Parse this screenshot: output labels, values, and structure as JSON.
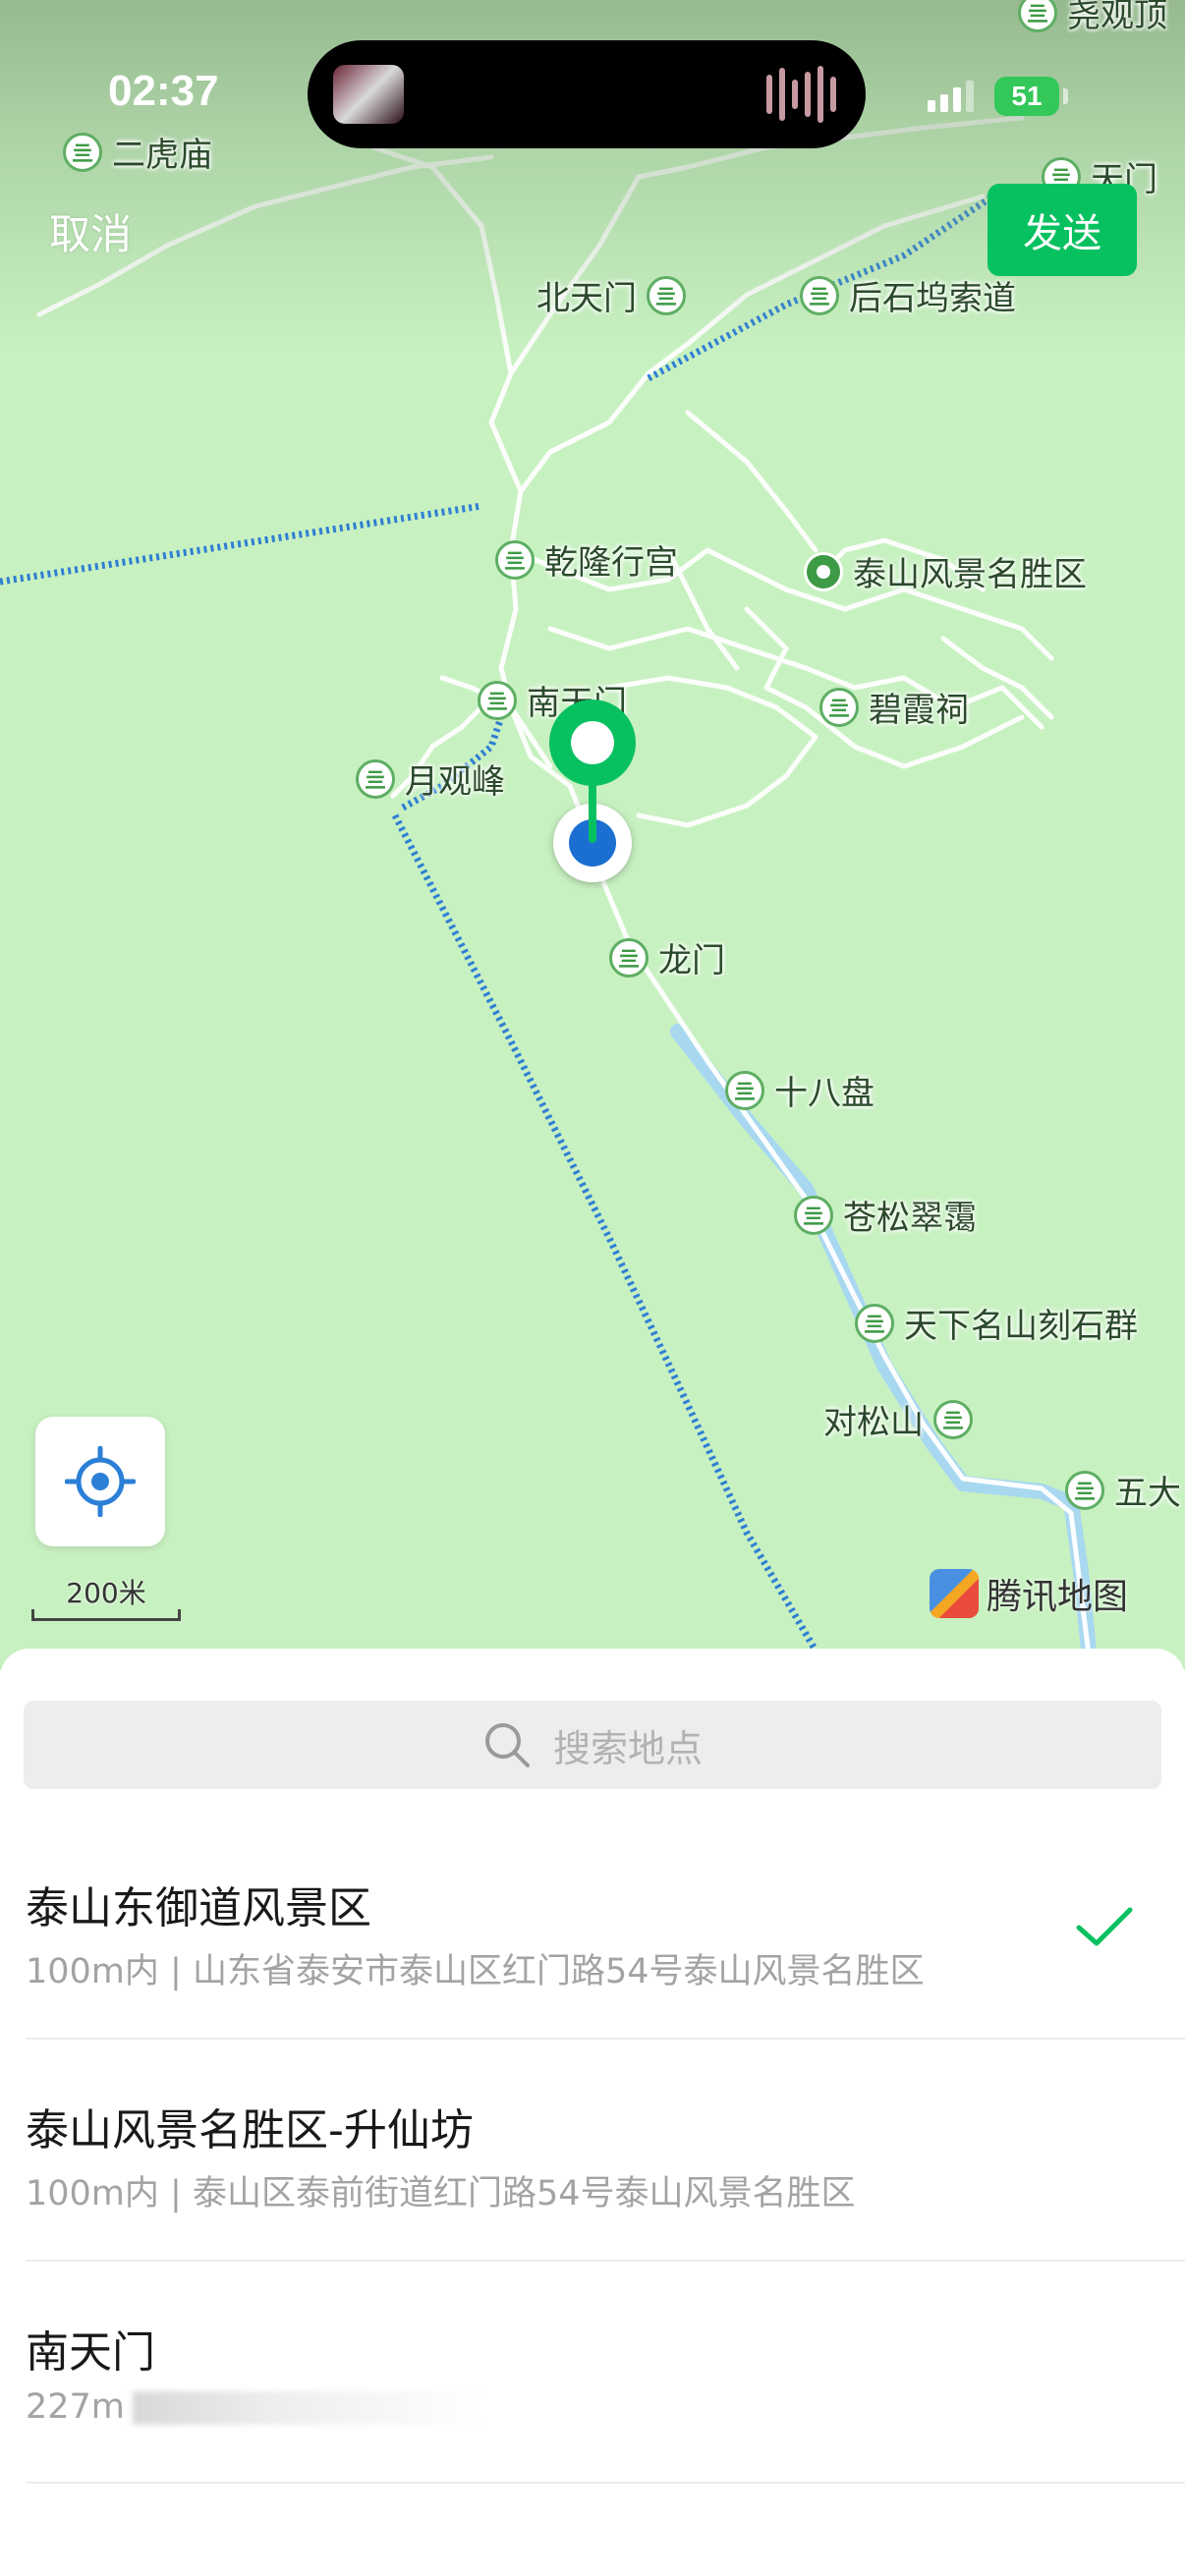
{
  "status_bar": {
    "time": "02:37",
    "battery": "51"
  },
  "header": {
    "cancel_label": "取消",
    "send_label": "发送"
  },
  "map": {
    "pois": [
      {
        "label": "二虎庙"
      },
      {
        "label": "尧观顶"
      },
      {
        "label": "北天门"
      },
      {
        "label": "后石坞索道"
      },
      {
        "label": "乾隆行宫"
      },
      {
        "label": "泰山风景名胜区"
      },
      {
        "label": "南天门"
      },
      {
        "label": "碧霞祠"
      },
      {
        "label": "月观峰"
      },
      {
        "label": "龙门"
      },
      {
        "label": "十八盘"
      },
      {
        "label": "苍松翠霭"
      },
      {
        "label": "天下名山刻石群"
      },
      {
        "label": "对松山"
      },
      {
        "label": "五大"
      },
      {
        "label": "天门"
      }
    ],
    "scale_label": "200米",
    "provider": "腾讯地图"
  },
  "search": {
    "placeholder": "搜索地点"
  },
  "results": [
    {
      "name": "泰山东御道风景区",
      "address": "100m内 | 山东省泰安市泰山区红门路54号泰山风景名胜区",
      "selected": true
    },
    {
      "name": "泰山风景名胜区-升仙坊",
      "address": "100m内 | 泰山区泰前街道红门路54号泰山风景名胜区",
      "selected": false
    },
    {
      "name": "南天门",
      "address": "227m",
      "selected": false
    }
  ],
  "colors": {
    "accent": "#07c160",
    "map_bg": "#c8f1c1",
    "cable": "#2f7fd3",
    "river": "#a8d8f0"
  }
}
